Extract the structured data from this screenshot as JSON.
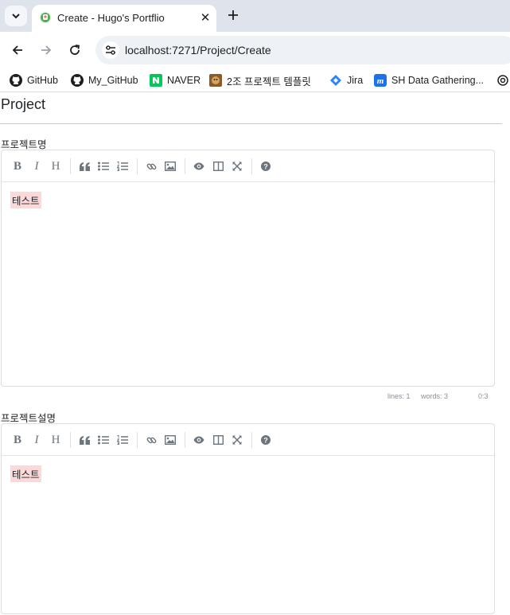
{
  "browser": {
    "tab": {
      "title": "Create - Hugo's Portflio"
    },
    "url": "localhost:7271/Project/Create",
    "bookmarks": [
      {
        "label": "GitHub",
        "icon": "github-icon"
      },
      {
        "label": "My_GitHub",
        "icon": "github-icon"
      },
      {
        "label": "NAVER",
        "icon": "naver-icon"
      },
      {
        "label": "2조 프로젝트 템플릿",
        "icon": "template-icon"
      },
      {
        "label": "Jira",
        "icon": "jira-icon"
      },
      {
        "label": "SH Data Gathering...",
        "icon": "m-icon"
      }
    ],
    "colors": {
      "tabstrip": "#dee3ec",
      "omnibox": "#eef1f6",
      "naver": "#03c75a",
      "jira": "#2684ff",
      "m_app": "#1a73e8"
    }
  },
  "page": {
    "title": "Project",
    "fields": [
      {
        "label": "프로젝트명",
        "value": "테스트"
      },
      {
        "label": "프로젝트설명",
        "value": "테스트"
      }
    ],
    "status": {
      "lines": "lines: 1",
      "words": "words: 3",
      "cursor": "0:3"
    },
    "editor_toolbar": [
      "bold",
      "italic",
      "heading",
      "quote",
      "unordered-list",
      "ordered-list",
      "link",
      "image",
      "preview",
      "side-by-side",
      "fullscreen",
      "guide"
    ]
  }
}
